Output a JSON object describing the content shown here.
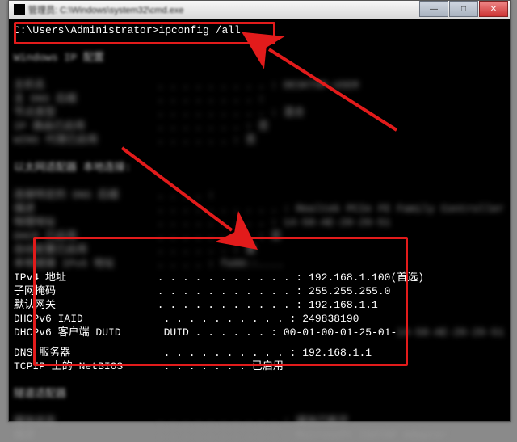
{
  "window": {
    "title": "管理员: C:\\Windows\\system32\\cmd.exe",
    "min_glyph": "—",
    "max_glyph": "□",
    "close_glyph": "✕"
  },
  "command_line": "C:\\Users\\Administrator>ipconfig /all",
  "blurred": {
    "section1_title": "Windows IP 配置",
    "host_label": "主机名",
    "dns_suffix_label": "主 DNS 后缀",
    "node_label": "节点类型",
    "routing_label": "IP 路由已启用",
    "wins_label": "WINS 代理已启用",
    "adapter_title": "以太网适配器 本地连接:",
    "conn_dns_label": "连接特定的 DNS 后缀",
    "desc_label": "描述",
    "phys_label": "物理地址",
    "dhcp_label": "DHCP 已启用",
    "auto_label": "自动配置已启用",
    "ipv6_label": "本地链接 IPv6 地址",
    "nic_value": "Realtek PCIe FE Family Controller",
    "mac_value": "14-58-AE-20-29-51",
    "tunnel_title": "隧道适配器",
    "media_label": "媒体状态",
    "media_value": "媒体已断开",
    "isatap_value": "Microsoft ISATAP Adapter"
  },
  "network": {
    "ipv4_label": "IPv4 地址",
    "ipv4_value": "192.168.1.100(首选)",
    "mask_label": "子网掩码",
    "mask_value": "255.255.255.0",
    "gateway_label": "默认网关",
    "gateway_value": "192.168.1.1",
    "iaid_label": "DHCPv6 IAID",
    "iaid_value": "249838190",
    "duid_label": "DHCPv6 客户端 DUID",
    "duid_value": "00-01-00-01-25-01-",
    "duid_tail": "14-58-AE-20-29-51",
    "dns_label": "DNS 服务器",
    "dns_value": "192.168.1.1",
    "netbios_label": "TCPIP 上的 NetBIOS",
    "netbios_value": "已启用"
  },
  "arrows": {
    "color": "#e21b1b"
  }
}
